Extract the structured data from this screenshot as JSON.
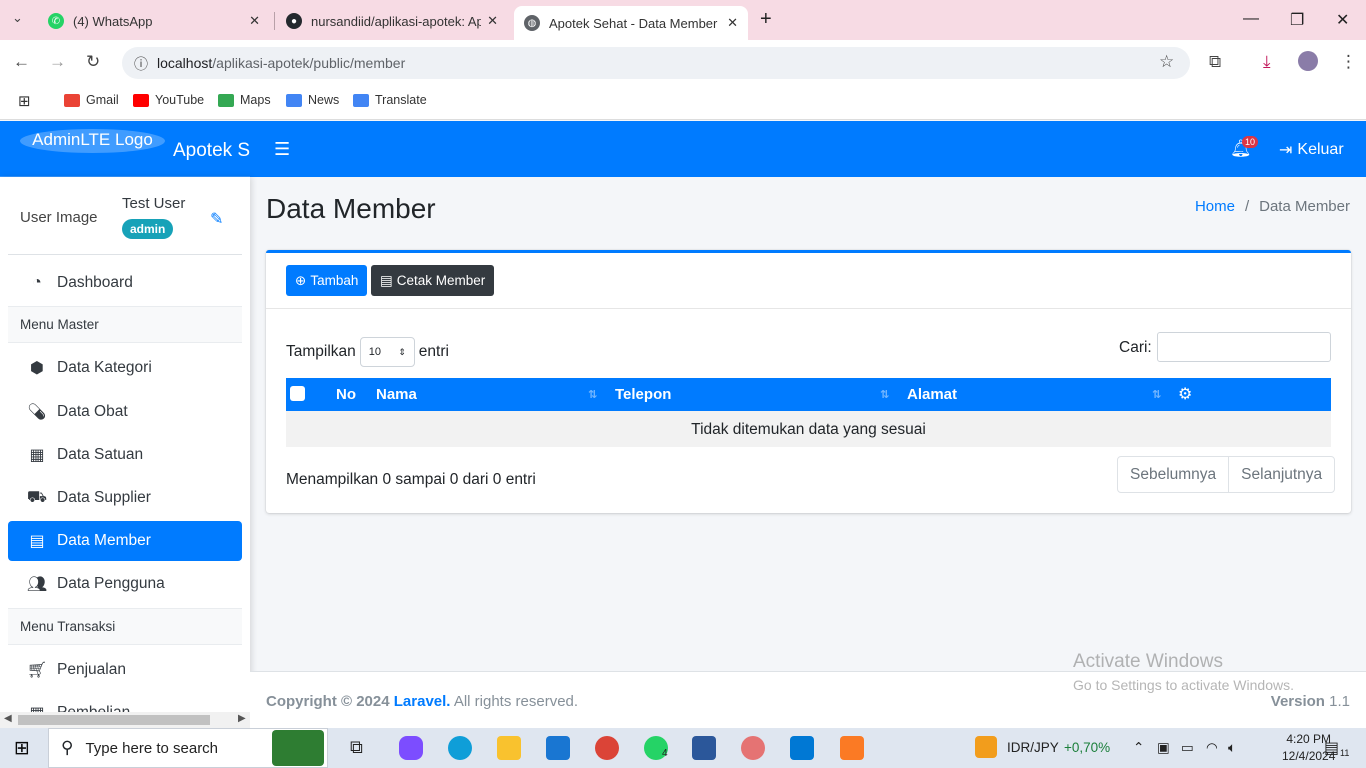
{
  "browser": {
    "tabs": [
      {
        "title": "(4) WhatsApp",
        "icon": "whatsapp-icon"
      },
      {
        "title": "nursandiid/aplikasi-apotek: Apl",
        "icon": "github-icon"
      },
      {
        "title": "Apotek Sehat - Data Member",
        "icon": "globe-icon"
      }
    ],
    "url_host": "localhost",
    "url_path": "/aplikasi-apotek/public/member",
    "bookmarks": [
      "Gmail",
      "YouTube",
      "Maps",
      "News",
      "Translate"
    ]
  },
  "app": {
    "logo_alt": "AdminLTE Logo",
    "brand": "Apotek Sehat",
    "notif_count": "10",
    "logout_label": "Keluar",
    "user": {
      "image_alt": "User Image",
      "name": "Test User",
      "role": "admin"
    },
    "menu": {
      "dashboard": "Dashboard",
      "header_master": "Menu Master",
      "kategori": "Data Kategori",
      "obat": "Data Obat",
      "satuan": "Data Satuan",
      "supplier": "Data Supplier",
      "member": "Data Member",
      "pengguna": "Data Pengguna",
      "header_transaksi": "Menu Transaksi",
      "penjualan": "Penjualan",
      "pembelian": "Pembelian"
    }
  },
  "page": {
    "title": "Data Member",
    "breadcrumb_home": "Home",
    "breadcrumb_sep": "/",
    "breadcrumb_current": "Data Member",
    "btn_tambah": "Tambah",
    "btn_cetak": "Cetak Member",
    "length_prefix": "Tampilkan",
    "length_value": "10",
    "length_suffix": "entri",
    "search_label": "Cari:",
    "columns": [
      "No",
      "Nama",
      "Telepon",
      "Alamat"
    ],
    "empty_text": "Tidak ditemukan data yang sesuai",
    "info_text": "Menampilkan 0 sampai 0 dari 0 entri",
    "prev": "Sebelumnya",
    "next": "Selanjutnya"
  },
  "footer": {
    "copy_prefix": "Copyright © 2024",
    "copy_link": "Laravel.",
    "copy_suffix": "All rights reserved.",
    "version_label": "Version",
    "version_value": "1.1"
  },
  "watermark": {
    "line1": "Activate Windows",
    "line2": "Go to Settings to activate Windows."
  },
  "taskbar": {
    "search_placeholder": "Type here to search",
    "currency": "IDR/JPY",
    "currency_change": "+0,70%",
    "time": "4:20 PM",
    "date": "12/4/2024",
    "whatsapp_badge": "4",
    "notif_count": "11"
  }
}
